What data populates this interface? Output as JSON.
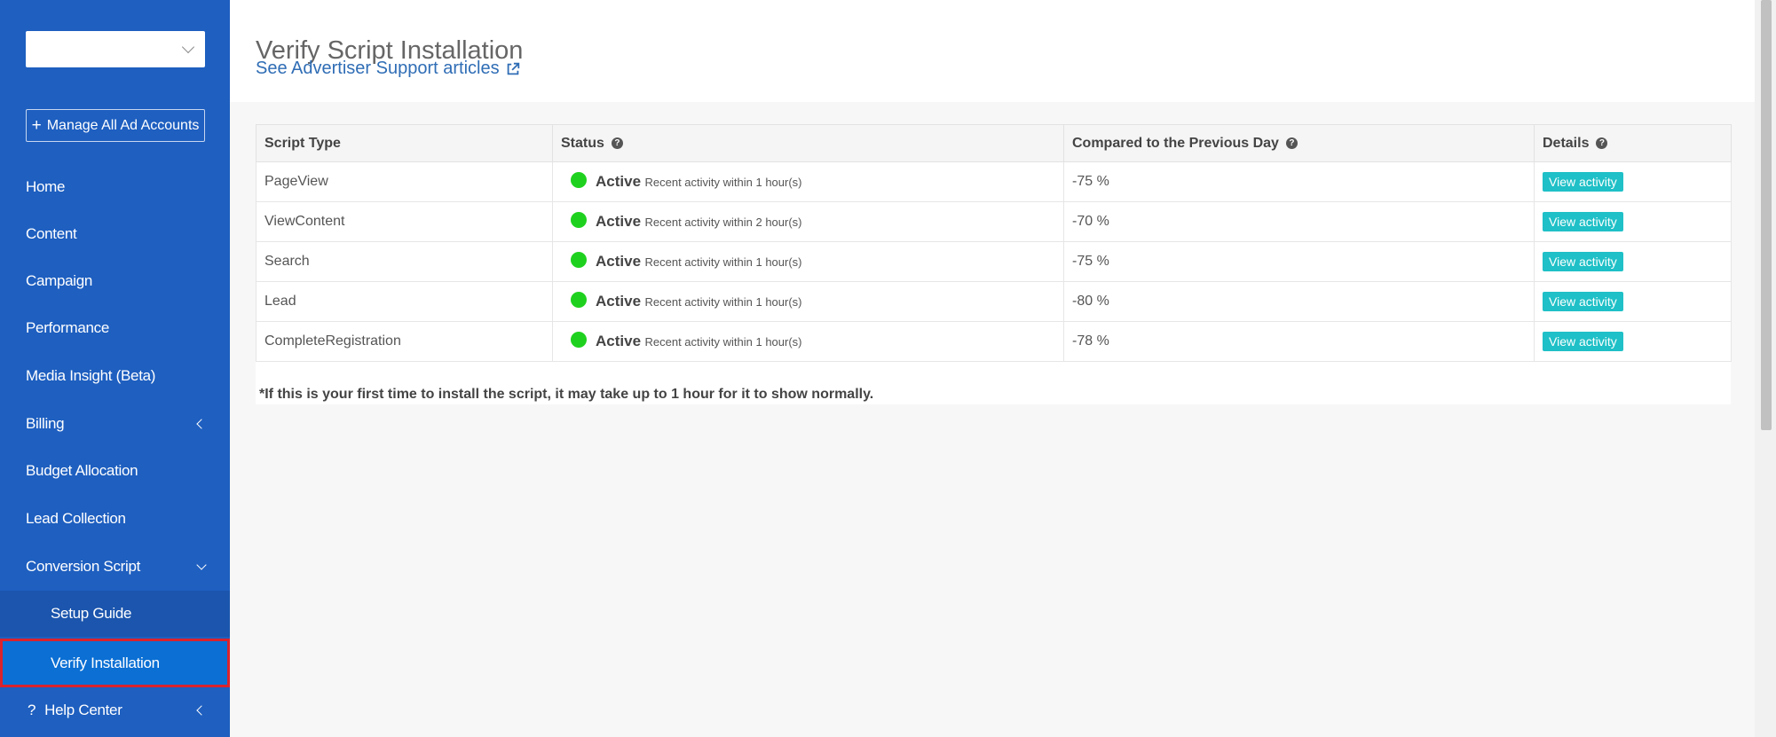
{
  "sidebar": {
    "account_selector_value": "",
    "manage_label": "Manage All Ad Accounts",
    "items": [
      {
        "label": "Home"
      },
      {
        "label": "Content"
      },
      {
        "label": "Campaign"
      },
      {
        "label": "Performance"
      },
      {
        "label": "Media Insight (Beta)"
      },
      {
        "label": "Billing"
      },
      {
        "label": "Budget Allocation"
      },
      {
        "label": "Lead Collection"
      },
      {
        "label": "Conversion Script"
      },
      {
        "label": "Setup Guide"
      },
      {
        "label": "Verify Installation"
      },
      {
        "label": "Help Center"
      }
    ],
    "help_prefix": "?"
  },
  "header": {
    "title": "Verify Script Installation",
    "support_link": "See Advertiser Support articles"
  },
  "table": {
    "columns": [
      "Script Type",
      "Status",
      "Compared to the Previous Day",
      "Details"
    ],
    "rows": [
      {
        "type": "PageView",
        "status": "Active",
        "note": "Recent activity within 1 hour(s)",
        "change": "-75 %",
        "action": "View activity"
      },
      {
        "type": "ViewContent",
        "status": "Active",
        "note": "Recent activity within 2 hour(s)",
        "change": "-70 %",
        "action": "View activity"
      },
      {
        "type": "Search",
        "status": "Active",
        "note": "Recent activity within 1 hour(s)",
        "change": "-75 %",
        "action": "View activity"
      },
      {
        "type": "Lead",
        "status": "Active",
        "note": "Recent activity within 1 hour(s)",
        "change": "-80 %",
        "action": "View activity"
      },
      {
        "type": "CompleteRegistration",
        "status": "Active",
        "note": "Recent activity within 1 hour(s)",
        "change": "-78 %",
        "action": "View activity"
      }
    ],
    "footnote": "*If this is your first time to install the script, it may take up to 1 hour for it to show normally."
  },
  "colors": {
    "sidebar_bg": "#1e5fc0",
    "active_item_bg": "#0b6fd4",
    "active_outline": "#d9232d",
    "status_active": "#1fd11f",
    "negative_change": "#e0302a",
    "button_teal": "#1fc0c7",
    "link_blue": "#2f6db5"
  },
  "icons": {
    "account_dropdown": "chevron-down-icon",
    "manage": "plus-icon",
    "collapsed": "chevron-left-icon",
    "expanded": "chevron-down-icon",
    "external": "external-link-icon",
    "help": "question-circle-icon",
    "status": "status-dot-icon"
  }
}
